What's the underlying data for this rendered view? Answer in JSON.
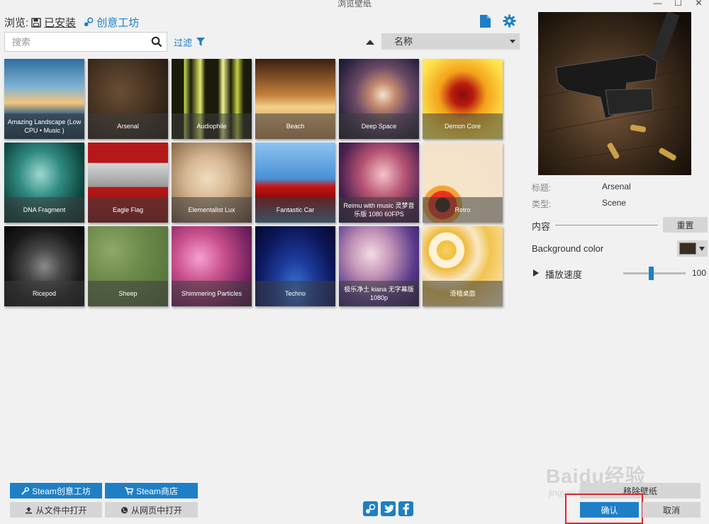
{
  "window": {
    "title": "浏览壁纸",
    "controls": [
      "—",
      "☐",
      "✕"
    ]
  },
  "browse": {
    "label": "浏览:",
    "installed": "已安装",
    "workshop": "创意工坊"
  },
  "search": {
    "placeholder": "搜索"
  },
  "filter": {
    "label": "过滤"
  },
  "sort": {
    "selected": "名称"
  },
  "wallpapers": [
    {
      "title": "Amazing Landscape (Low CPU • Music )",
      "selected": false
    },
    {
      "title": "Arsenal",
      "selected": true
    },
    {
      "title": "Audiophile",
      "selected": false
    },
    {
      "title": "Beach",
      "selected": false
    },
    {
      "title": "Deep Space",
      "selected": false
    },
    {
      "title": "Demon Core",
      "selected": false
    },
    {
      "title": "DNA Fragment",
      "selected": false
    },
    {
      "title": "Eagle Flag",
      "selected": false
    },
    {
      "title": "Elementalist Lux",
      "selected": false
    },
    {
      "title": "Fantastic Car",
      "selected": false
    },
    {
      "title": "Reimu with music 灵梦音乐版 1080 60FPS",
      "selected": false
    },
    {
      "title": "Retro",
      "selected": false
    },
    {
      "title": "Ricepod",
      "selected": false
    },
    {
      "title": "Sheep",
      "selected": false
    },
    {
      "title": "Shimmering Particles",
      "selected": false
    },
    {
      "title": "Techno",
      "selected": false
    },
    {
      "title": "极乐净土 kiana 无字幕版 1080p",
      "selected": false
    },
    {
      "title": "滑稽桌面",
      "selected": false
    }
  ],
  "details": {
    "title_label": "标题:",
    "title_value": "Arsenal",
    "type_label": "类型:",
    "type_value": "Scene",
    "content_label": "内容",
    "reset_label": "重置",
    "bgcolor_label": "Background color",
    "bgcolor_value": "#3a2c22",
    "speed_label": "播放速度",
    "speed_value": "100",
    "speed_fraction": 0.45
  },
  "buttons": {
    "steam_workshop": "Steam创意工坊",
    "steam_store": "Steam商店",
    "open_file": "从文件中打开",
    "open_web": "从网页中打开",
    "remove": "移除壁纸",
    "ok": "确认",
    "cancel": "取消"
  },
  "watermark": {
    "text": "Baidu经验",
    "sub": "jingyan.baidu.com"
  },
  "colors": {
    "accent": "#1e7fc6",
    "highlight": "#d92a2a"
  }
}
